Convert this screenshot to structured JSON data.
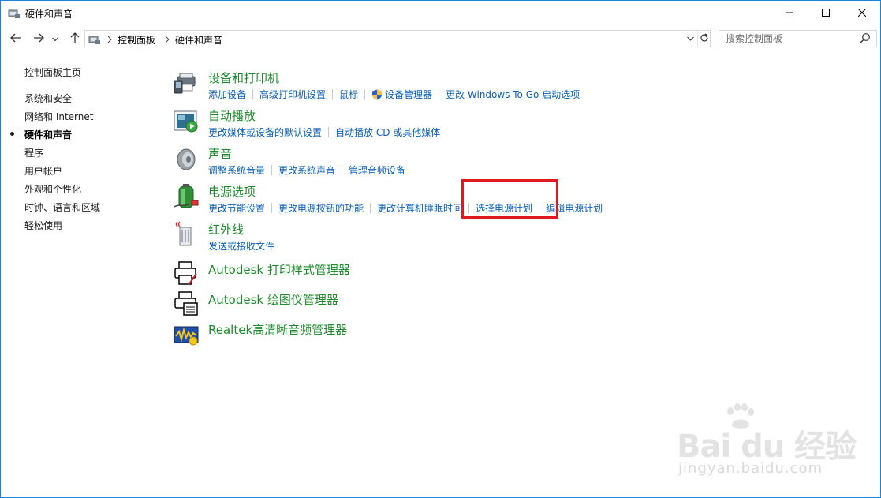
{
  "window": {
    "title": "硬件和声音",
    "min_icon": "minimize-icon",
    "max_icon": "maximize-icon",
    "close_icon": "close-icon"
  },
  "address_bar": {
    "breadcrumbs": [
      "控制面板",
      "硬件和声音"
    ],
    "search_placeholder": "搜索控制面板"
  },
  "left_nav": {
    "items": [
      {
        "label": "控制面板主页",
        "current": false
      },
      {
        "label": "系统和安全",
        "current": false
      },
      {
        "label": "网络和 Internet",
        "current": false
      },
      {
        "label": "硬件和声音",
        "current": true
      },
      {
        "label": "程序",
        "current": false
      },
      {
        "label": "用户帐户",
        "current": false
      },
      {
        "label": "外观和个性化",
        "current": false
      },
      {
        "label": "时钟、语言和区域",
        "current": false
      },
      {
        "label": "轻松使用",
        "current": false
      }
    ]
  },
  "categories": [
    {
      "title": "设备和打印机",
      "icon": "devices-printers-icon",
      "links": [
        "添加设备",
        "高级打印机设置",
        "鼠标",
        "设备管理器",
        "更改 Windows To Go 启动选项"
      ]
    },
    {
      "title": "自动播放",
      "icon": "autoplay-icon",
      "links": [
        "更改媒体或设备的默认设置",
        "自动播放 CD 或其他媒体"
      ]
    },
    {
      "title": "声音",
      "icon": "speaker-icon",
      "links": [
        "调整系统音量",
        "更改系统声音",
        "管理音频设备"
      ]
    },
    {
      "title": "电源选项",
      "icon": "battery-icon",
      "links": [
        "更改节能设置",
        "更改电源按钮的功能",
        "更改计算机睡眠时间",
        "选择电源计划",
        "编辑电源计划"
      ]
    },
    {
      "title": "红外线",
      "icon": "infrared-icon",
      "links": [
        "发送或接收文件"
      ]
    },
    {
      "title": "Autodesk 打印样式管理器",
      "icon": "printer-style-icon",
      "links": []
    },
    {
      "title": "Autodesk 绘图仪管理器",
      "icon": "plotter-icon",
      "links": []
    },
    {
      "title": "Realtek高清晰音频管理器",
      "icon": "realtek-audio-icon",
      "links": []
    }
  ],
  "colors": {
    "accent": "#1883d7",
    "category_title": "#1e8c2c",
    "link": "#0b61b7",
    "highlight": "#e0191d"
  },
  "watermark": {
    "main": "Bai du 经验",
    "sub": "jingyan.baidu.com"
  }
}
